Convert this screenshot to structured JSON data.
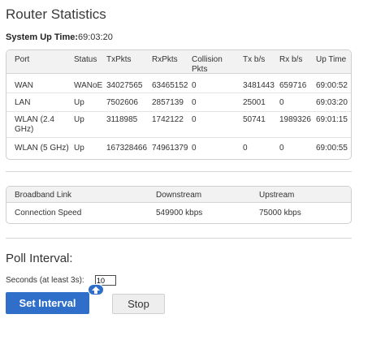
{
  "page": {
    "title": "Router Statistics"
  },
  "uptime": {
    "label": "System Up Time:",
    "value": "69:03:20"
  },
  "stats": {
    "headers": [
      "Port",
      "Status",
      "TxPkts",
      "RxPkts",
      "Collision Pkts",
      "Tx b/s",
      "Rx b/s",
      "Up Time"
    ],
    "rows": [
      [
        "WAN",
        "WANoE",
        "34027565",
        "63465152",
        "0",
        "3481443",
        "659716",
        "69:00:52"
      ],
      [
        "LAN",
        "Up",
        "7502606",
        "2857139",
        "0",
        "25001",
        "0",
        "69:03:20"
      ],
      [
        "WLAN (2.4 GHz)",
        "Up",
        "3118985",
        "1742122",
        "0",
        "50741",
        "1989326",
        "69:01:15"
      ],
      [
        "WLAN (5 GHz)",
        "Up",
        "167328466",
        "74961379",
        "0",
        "0",
        "0",
        "69:00:55"
      ]
    ]
  },
  "broadband": {
    "headers": [
      "Broadband Link",
      "Downstream",
      "Upstream"
    ],
    "row": [
      "Connection Speed",
      "549900 kbps",
      "75000 kbps"
    ]
  },
  "poll": {
    "title": "Poll Interval:",
    "seconds_label": "Seconds (at least 3s):",
    "seconds_value": "10",
    "set_label": "Set Interval",
    "stop_label": "Stop"
  },
  "colors": {
    "accent": "#2f6fc9",
    "header_bg": "#f2f2f2"
  },
  "icons": {
    "drag_handle": "cursor-handle-icon"
  }
}
